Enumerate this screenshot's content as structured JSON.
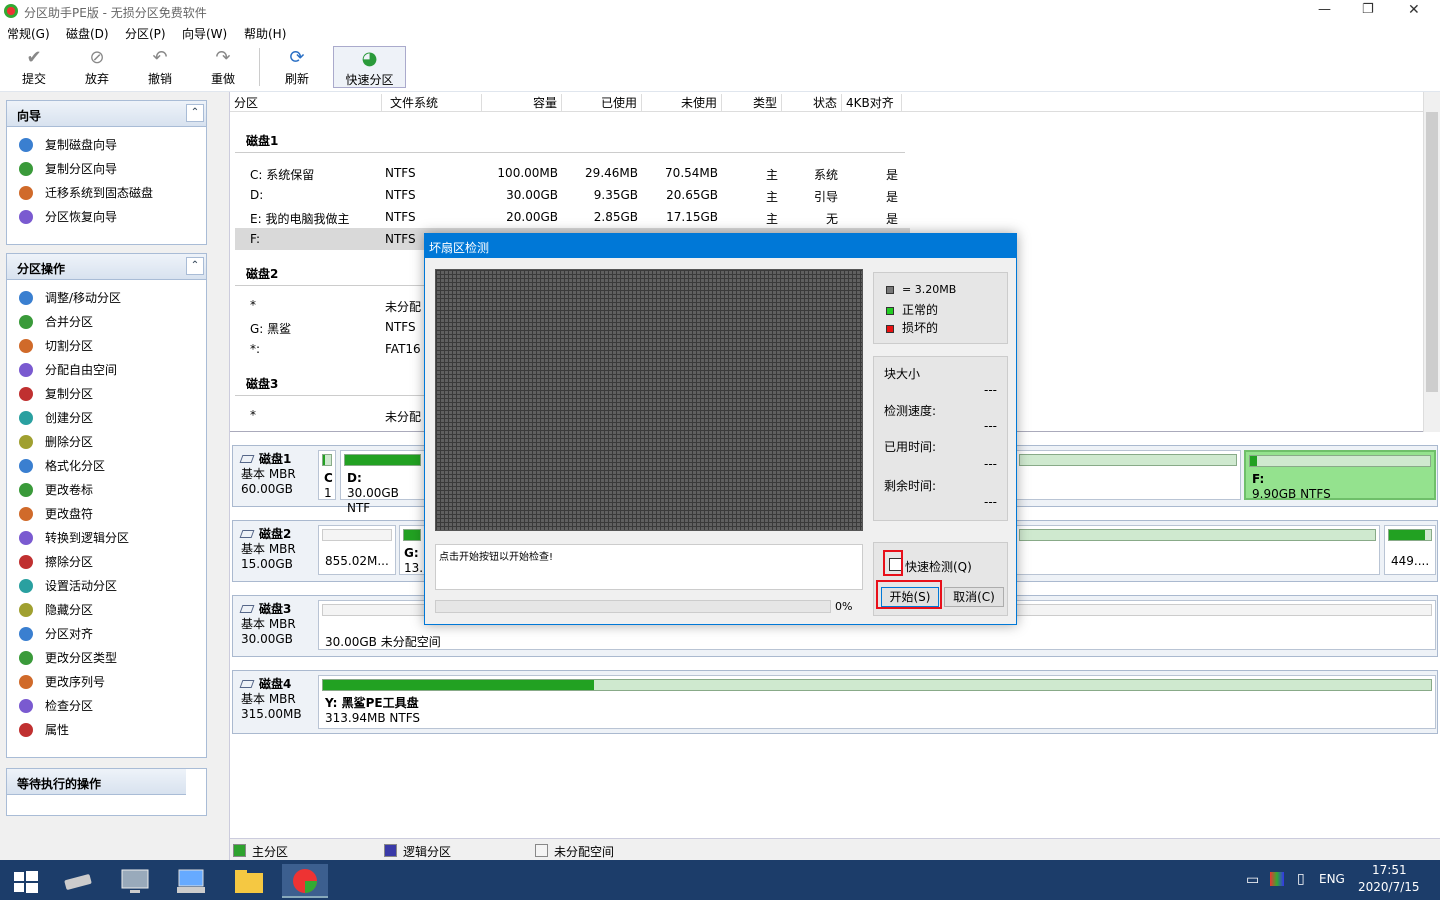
{
  "window": {
    "title": "分区助手PE版 - 无损分区免费软件",
    "controls": [
      "—",
      "❐",
      "✕"
    ]
  },
  "menu": [
    "常规(G)",
    "磁盘(D)",
    "分区(P)",
    "向导(W)",
    "帮助(H)"
  ],
  "toolbar": {
    "submit": "提交",
    "discard": "放弃",
    "undo": "撤销",
    "redo": "重做",
    "refresh": "刷新",
    "quick_partition": "快速分区"
  },
  "wizard_panel": {
    "title": "向导",
    "items": [
      "复制磁盘向导",
      "复制分区向导",
      "迁移系统到固态磁盘",
      "分区恢复向导"
    ]
  },
  "ops_panel": {
    "title": "分区操作",
    "items": [
      "调整/移动分区",
      "合并分区",
      "切割分区",
      "分配自由空间",
      "复制分区",
      "创建分区",
      "删除分区",
      "格式化分区",
      "更改卷标",
      "更改盘符",
      "转换到逻辑分区",
      "擦除分区",
      "设置活动分区",
      "隐藏分区",
      "分区对齐",
      "更改分区类型",
      "更改序列号",
      "检查分区",
      "属性"
    ]
  },
  "pending_panel": {
    "title": "等待执行的操作"
  },
  "grid": {
    "headers": [
      "分区",
      "文件系统",
      "容量",
      "已使用",
      "未使用",
      "类型",
      "状态",
      "4KB对齐"
    ],
    "disk1": "磁盘1",
    "disk1_rows": [
      [
        "C: 系统保留",
        "NTFS",
        "100.00MB",
        "29.46MB",
        "70.54MB",
        "主",
        "系统",
        "是"
      ],
      [
        "D:",
        "NTFS",
        "30.00GB",
        "9.35GB",
        "20.65GB",
        "主",
        "引导",
        "是"
      ],
      [
        "E: 我的电脑我做主",
        "NTFS",
        "20.00GB",
        "2.85GB",
        "17.15GB",
        "主",
        "无",
        "是"
      ],
      [
        "F:",
        "NTFS"
      ]
    ],
    "disk2": "磁盘2",
    "disk2_rows": [
      [
        "*",
        "未分配"
      ],
      [
        "G: 黑鲨",
        "NTFS"
      ],
      [
        "*:",
        "FAT16"
      ]
    ],
    "disk3": "磁盘3",
    "disk3_rows": [
      [
        "*",
        "未分配"
      ]
    ]
  },
  "disks": [
    {
      "name": "磁盘1",
      "type": "基本 MBR",
      "size": "60.00GB"
    },
    {
      "name": "磁盘2",
      "type": "基本 MBR",
      "size": "15.00GB"
    },
    {
      "name": "磁盘3",
      "type": "基本 MBR",
      "size": "30.00GB"
    },
    {
      "name": "磁盘4",
      "type": "基本 MBR",
      "size": "315.00MB"
    }
  ],
  "diskmap": {
    "d1_c": "C",
    "d1_c2": "1",
    "d1_d": "D:",
    "d1_d_size": "30.00GB NTF",
    "d1_f": "F:",
    "d1_f_size": "9.90GB NTFS",
    "d2_unalloc": "855.02M...",
    "d2_g": "G:",
    "d2_g_size": "13.",
    "d2_last": "449....",
    "d3_text": "30.00GB 未分配空间",
    "d4_title": "Y: 黑鲨PE工具盘",
    "d4_size": "313.94MB NTFS",
    "d4_used_fraction": 0.245
  },
  "legend_bar": {
    "primary": "主分区",
    "logical": "逻辑分区",
    "unalloc": "未分配空间"
  },
  "colors": {
    "primary": "#22a122",
    "logical": "#3a3aa8",
    "titlebar": "#0078d7",
    "taskbar": "#1c3d6a"
  },
  "dialog": {
    "title": "坏扇区检测",
    "legend_block": "= 3.20MB",
    "legend_ok": "正常的",
    "legend_bad": "损坏的",
    "block_size_label": "块大小",
    "speed_label": "检测速度:",
    "elapsed_label": "已用时间:",
    "remaining_label": "剩余时间:",
    "dash": "---",
    "log": "点击开始按钮以开始检查!",
    "progress_pct": "0%",
    "quick_check": "快速检测(Q)",
    "start": "开始(S)",
    "cancel": "取消(C)"
  },
  "tray": {
    "lang": "ENG",
    "time": "17:51",
    "date": "2020/7/15"
  }
}
